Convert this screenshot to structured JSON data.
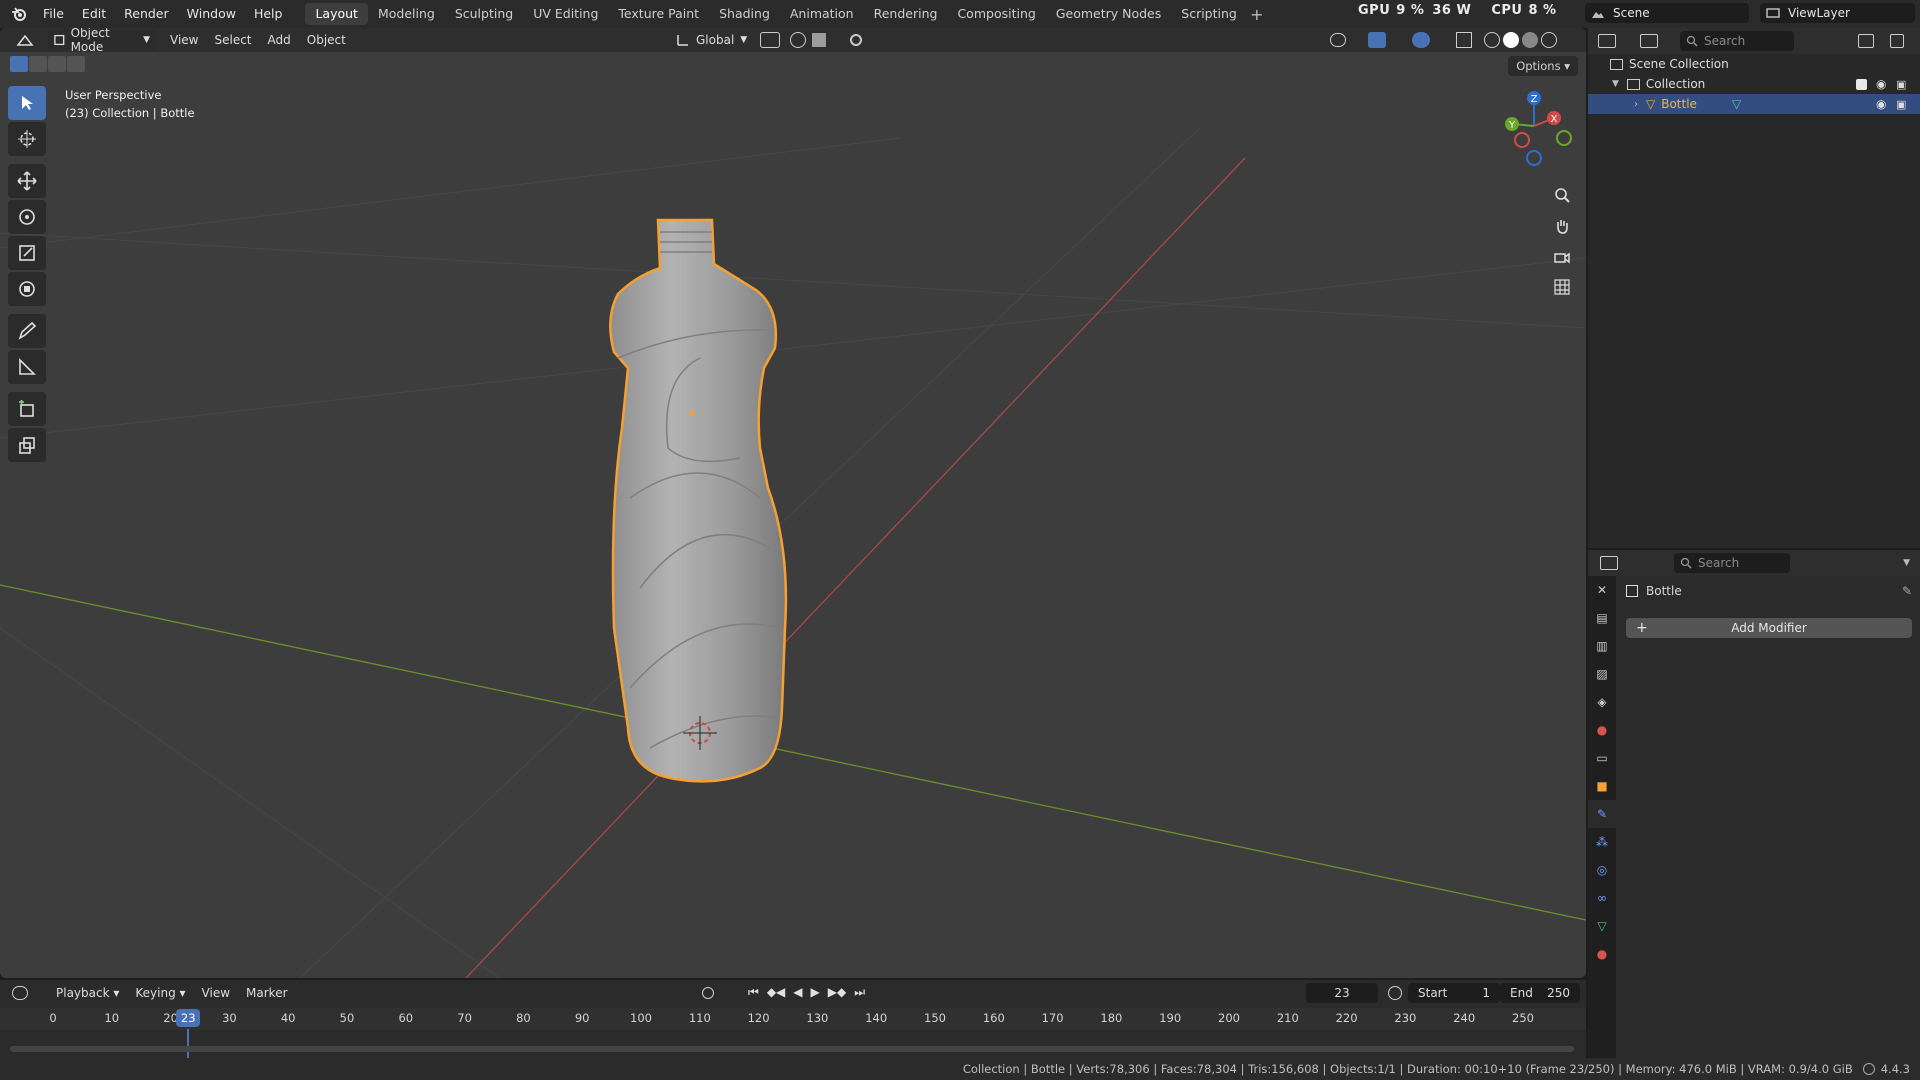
{
  "topbar": {
    "menus": [
      "File",
      "Edit",
      "Render",
      "Window",
      "Help"
    ],
    "workspaces": [
      "Layout",
      "Modeling",
      "Sculpting",
      "UV Editing",
      "Texture Paint",
      "Shading",
      "Animation",
      "Rendering",
      "Compositing",
      "Geometry Nodes",
      "Scripting"
    ],
    "active_workspace": "Layout",
    "gpu_label": "GPU",
    "gpu_value": "9 %",
    "gpu_power": "36 W",
    "cpu_label": "CPU",
    "cpu_value": "8 %",
    "scene": "Scene",
    "view_layer": "ViewLayer"
  },
  "viewport": {
    "mode": "Object Mode",
    "menus": [
      "View",
      "Select",
      "Add",
      "Object"
    ],
    "orientation": "Global",
    "options_label": "Options",
    "view_name": "User Perspective",
    "context_line": "(23) Collection | Bottle",
    "gizmo_axes": [
      "Z",
      "X",
      "Y"
    ]
  },
  "timeline": {
    "menus": [
      "Playback",
      "Keying",
      "View",
      "Marker"
    ],
    "current_frame": "23",
    "start_label": "Start",
    "start_value": "1",
    "end_label": "End",
    "end_value": "250",
    "ticks": [
      "0",
      "10",
      "20",
      "30",
      "40",
      "50",
      "60",
      "70",
      "80",
      "90",
      "100",
      "110",
      "120",
      "130",
      "140",
      "150",
      "160",
      "170",
      "180",
      "190",
      "200",
      "210",
      "220",
      "230",
      "240",
      "250"
    ]
  },
  "statusbar": {
    "text": "Collection | Bottle | Verts:78,306 | Faces:78,304 | Tris:156,608 | Objects:1/1 | Duration: 00:10+10 (Frame 23/250) | Memory: 476.0 MiB | VRAM: 0.9/4.0 GiB",
    "version": "4.4.3"
  },
  "outliner": {
    "search_placeholder": "Search",
    "scene_collection": "Scene Collection",
    "collection": "Collection",
    "object": "Bottle"
  },
  "properties": {
    "search_placeholder": "Search",
    "object_name": "Bottle",
    "add_modifier": "Add Modifier"
  },
  "colors": {
    "accent": "#4772b3",
    "selection_outline": "#f5a030",
    "x_axis": "#b04a4a",
    "y_axis": "#6b8f2a"
  }
}
